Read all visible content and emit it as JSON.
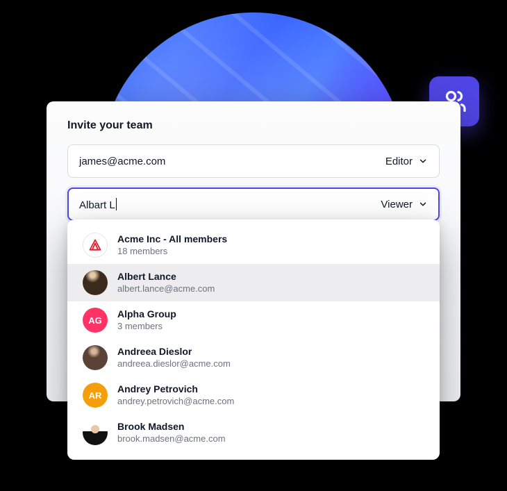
{
  "title": "Invite your team",
  "rows": [
    {
      "value": "james@acme.com",
      "role": "Editor"
    },
    {
      "value": "Albart L",
      "role": "Viewer"
    }
  ],
  "suggestions": [
    {
      "name": "Acme Inc - All members",
      "sub": "18 members",
      "avatarKind": "logo",
      "initials": ""
    },
    {
      "name": "Albert Lance",
      "sub": "albert.lance@acme.com",
      "avatarKind": "photo1",
      "initials": ""
    },
    {
      "name": "Alpha Group",
      "sub": "3 members",
      "avatarKind": "ag",
      "initials": "AG"
    },
    {
      "name": "Andreea Dieslor",
      "sub": "andreea.dieslor@acme.com",
      "avatarKind": "photo2",
      "initials": ""
    },
    {
      "name": "Andrey Petrovich",
      "sub": "andrey.petrovich@acme.com",
      "avatarKind": "ar",
      "initials": "AR"
    },
    {
      "name": "Brook Madsen",
      "sub": "brook.madsen@acme.com",
      "avatarKind": "photo3",
      "initials": ""
    }
  ],
  "highlightedIndex": 1
}
